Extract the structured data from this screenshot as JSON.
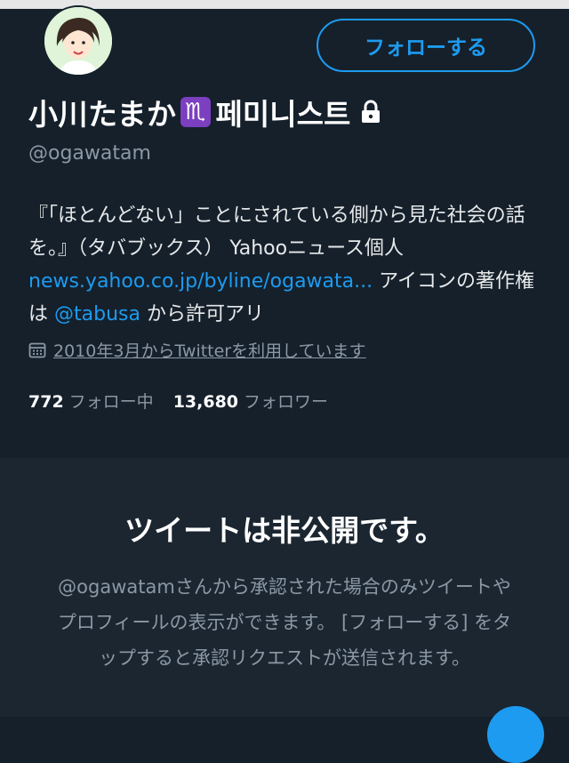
{
  "header": {
    "follow_button": "フォローする"
  },
  "profile": {
    "name": "小川たまか",
    "zodiac": "♏",
    "name_suffix": "페미니스트",
    "handle": "@ogawatam",
    "bio_text1": "『「ほとんどない」ことにされている側から見た社会の話を。』（タバブックス） Yahooニュース個人 ",
    "bio_link": "news.yahoo.co.jp/byline/ogawata...",
    "bio_text2": " アイコンの著作権は ",
    "bio_mention": "@tabusa",
    "bio_text3": " から許可アリ",
    "joined": "2010年3月からTwitterを利用しています",
    "following_count": "772",
    "following_label": "フォロー中",
    "followers_count": "13,680",
    "followers_label": "フォロワー"
  },
  "private_notice": {
    "title": "ツイートは非公開です。",
    "description": "@ogawatamさんから承認された場合のみツイートやプロフィールの表示ができます。 [フォローする] をタップすると承認リクエストが送信されます。"
  },
  "colors": {
    "background": "#15202b",
    "accent": "#1d9bf0",
    "muted": "#8b98a5"
  },
  "icons": [
    "lock-icon",
    "calendar-icon",
    "avatar",
    "compose-fab"
  ]
}
